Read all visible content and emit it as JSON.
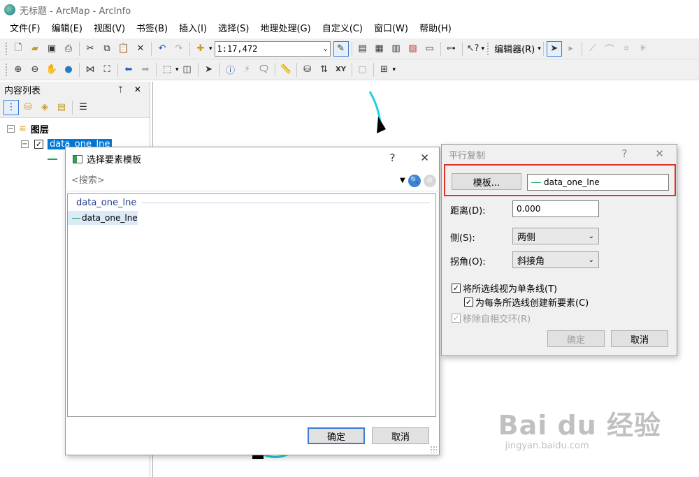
{
  "window": {
    "title": "无标题 - ArcMap - ArcInfo"
  },
  "menu": [
    "文件(F)",
    "编辑(E)",
    "视图(V)",
    "书签(B)",
    "插入(I)",
    "选择(S)",
    "地理处理(G)",
    "自定义(C)",
    "窗口(W)",
    "帮助(H)"
  ],
  "toolbar": {
    "scale": "1:17,472",
    "editor_label": "编辑器(R)"
  },
  "toc": {
    "title": "内容列表",
    "pin_close": "ᛘ ✕",
    "root": "图层",
    "layer": "data_one_lne"
  },
  "template_dialog": {
    "title": "选择要素模板",
    "help": "?",
    "close": "✕",
    "search_placeholder": "<搜索>",
    "group_header": "data_one_lne",
    "item": "data_one_lne",
    "ok": "确定",
    "cancel": "取消"
  },
  "parallel_dialog": {
    "title": "平行复制",
    "help": "?",
    "close": "✕",
    "template_button": "模板...",
    "template_value": "data_one_lne",
    "distance_label": "距离(D):",
    "distance_value": "0.000",
    "side_label": "侧(S):",
    "side_value": "两侧",
    "corner_label": "拐角(O):",
    "corner_value": "斜接角",
    "chk1": "将所选线视为单条线(T)",
    "chk2": "为每条所选线创建新要素(C)",
    "chk3": "移除自相交环(R)",
    "ok": "确定",
    "cancel": "取消"
  },
  "watermark": {
    "logo": "Bai du 经验",
    "url": "jingyan.baidu.com"
  },
  "colors": {
    "accent": "#0078d7",
    "highlight": "#e0302a",
    "feature_line": "#20d0e0"
  }
}
